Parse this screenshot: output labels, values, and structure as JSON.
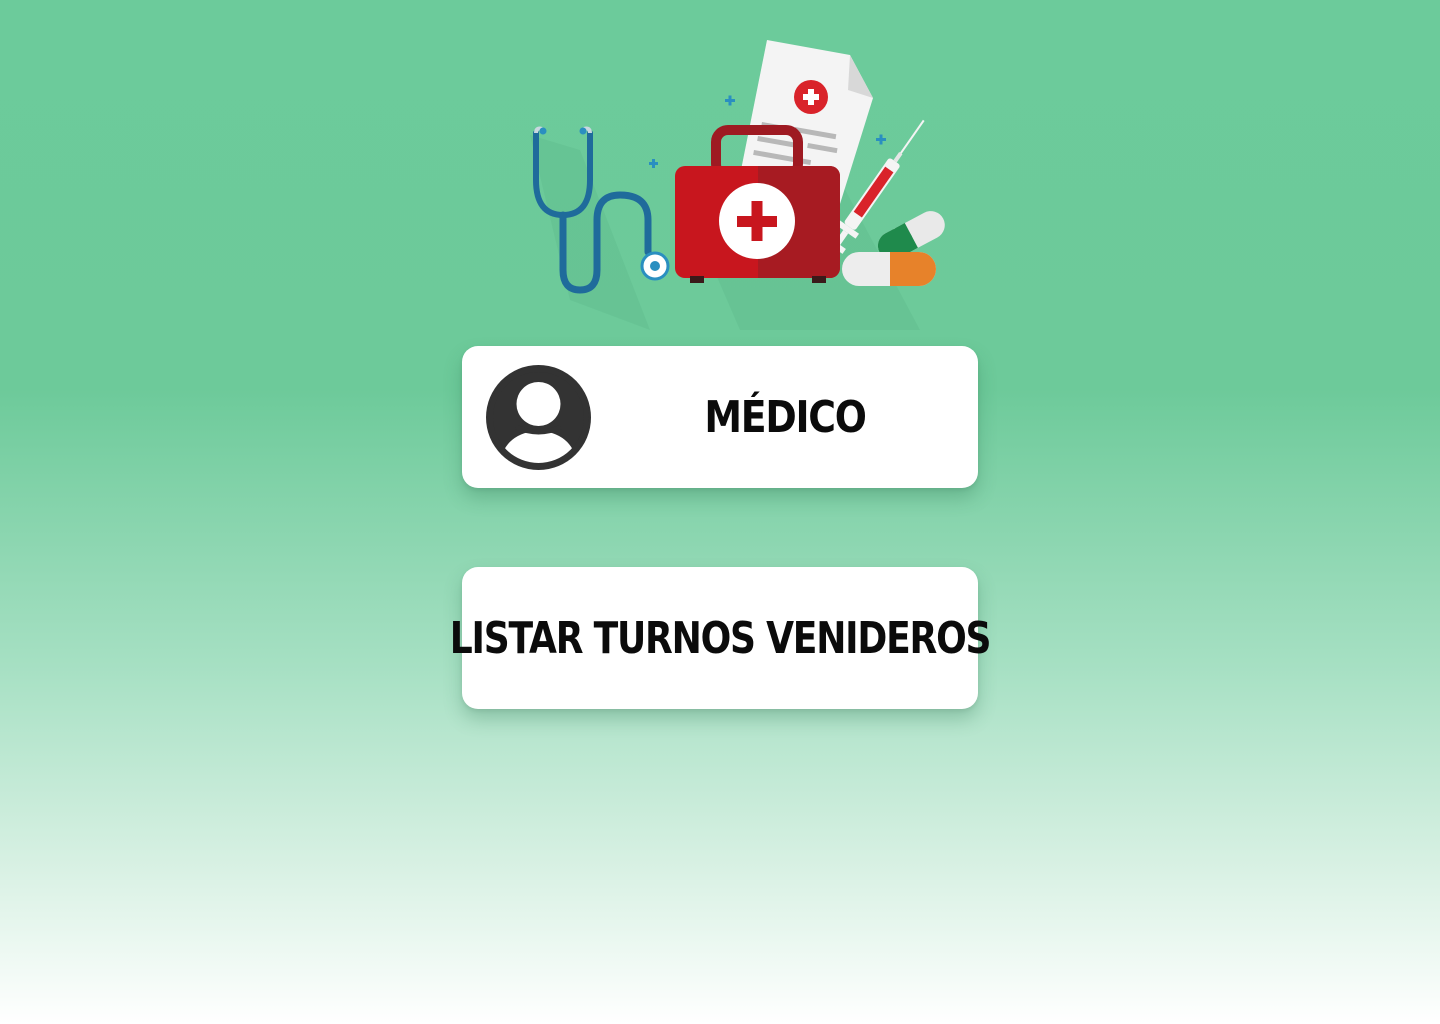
{
  "hero": {
    "icons": [
      "stethoscope-icon",
      "first-aid-kit-icon",
      "medical-document-icon",
      "syringe-icon",
      "pills-icon",
      "plus-sparkle-icon"
    ]
  },
  "profile_card": {
    "avatar_icon": "user-avatar-icon",
    "label": "MÉDICO"
  },
  "action_card": {
    "label": "LISTAR TURNOS VENIDEROS"
  },
  "colors": {
    "background_top": "#6ccb9b",
    "background_bottom": "#ffffff",
    "card": "#ffffff",
    "text": "#0b0b0b",
    "kit_red": "#c8161e",
    "stethoscope_blue": "#1f6b9b",
    "pill_orange": "#e7822a"
  }
}
